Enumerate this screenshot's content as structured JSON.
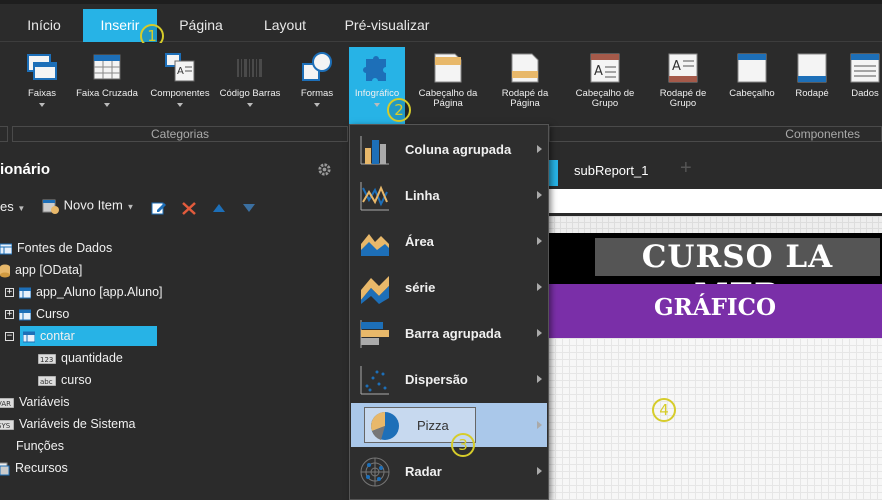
{
  "tabs": [
    {
      "label": "Início"
    },
    {
      "label": "Inserir"
    },
    {
      "label": "Página"
    },
    {
      "label": "Layout"
    },
    {
      "label": "Pré-visualizar"
    }
  ],
  "badges": [
    "1",
    "2",
    "3",
    "4"
  ],
  "ribbon": [
    {
      "label": "Faixas"
    },
    {
      "label": "Faixa Cruzada"
    },
    {
      "label": "Componentes"
    },
    {
      "label": "Código Barras"
    },
    {
      "label": "Formas"
    },
    {
      "label": "Infográfico"
    },
    {
      "label": "Cabeçalho da Página"
    },
    {
      "label": "Rodapé da Página"
    },
    {
      "label": "Cabeçalho de Grupo"
    },
    {
      "label": "Rodapé de Grupo"
    },
    {
      "label": "Cabeçalho"
    },
    {
      "label": "Rodapé"
    },
    {
      "label": "Dados"
    }
  ],
  "categories": {
    "left": "Categorias",
    "right": "Componentes"
  },
  "dictionary": {
    "title": "ionário",
    "toolbar": {
      "actions": "es",
      "new_item": "Novo Item"
    },
    "tree": [
      {
        "label": "Fontes de Dados"
      },
      {
        "label": "app [OData]"
      },
      {
        "label": "app_Aluno [app.Aluno]"
      },
      {
        "label": "Curso"
      },
      {
        "label": "contar"
      },
      {
        "label": "quantidade"
      },
      {
        "label": "curso"
      },
      {
        "label": "Variáveis"
      },
      {
        "label": "Variáveis de Sistema"
      },
      {
        "label": "Funções"
      },
      {
        "label": "Recursos"
      }
    ]
  },
  "report": {
    "tab": "subReport_1",
    "add": "+",
    "banner": "CURSO LA MER",
    "subtitle": "GRÁFICO"
  },
  "menu": [
    {
      "label": "Coluna agrupada"
    },
    {
      "label": "Linha"
    },
    {
      "label": "Área"
    },
    {
      "label": "série"
    },
    {
      "label": "Barra agrupada"
    },
    {
      "label": "Dispersão"
    },
    {
      "label": "Pizza"
    },
    {
      "label": "Radar"
    }
  ],
  "colors": {
    "accent": "#27b3e6",
    "badge": "#d6cc2a",
    "purple": "#7a2fa8",
    "menu_highlight": "#aac8ea"
  }
}
